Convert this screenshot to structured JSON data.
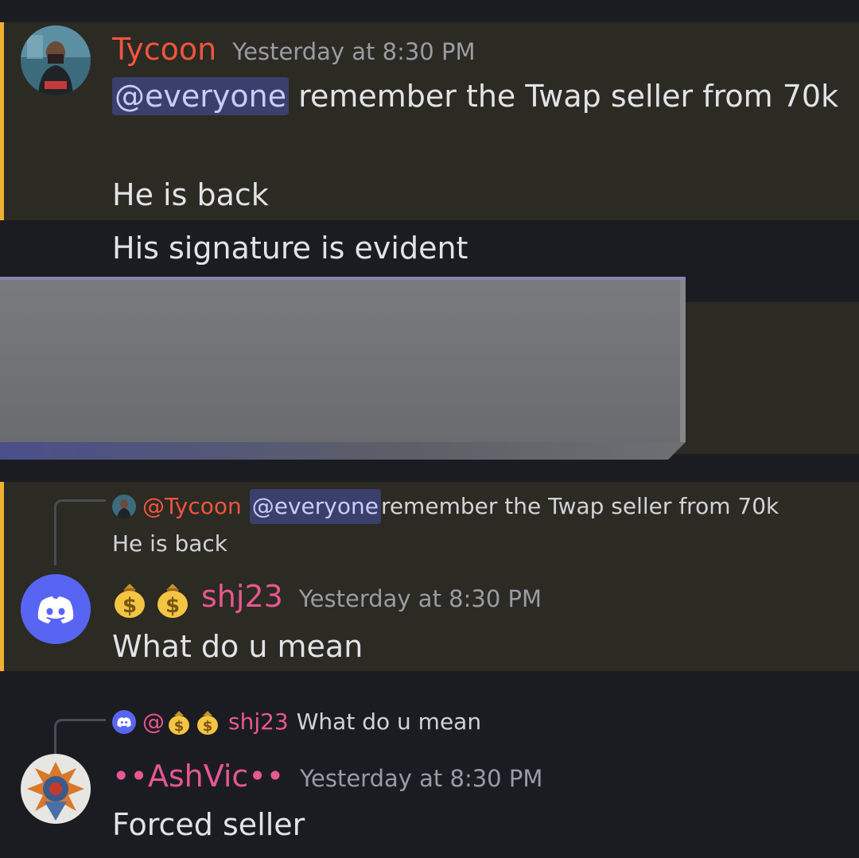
{
  "messages": [
    {
      "author": "Tycoon",
      "author_color": "#f0553f",
      "timestamp": "Yesterday at 8:30 PM",
      "mention": "@everyone",
      "line1_rest": " remember the Twap seller from 70k",
      "line2": "He is back"
    },
    {
      "text": "His signature is evident"
    },
    {
      "reply": {
        "author": "@Tycoon",
        "mention": "@everyone",
        "text_rest": " remember the Twap seller from 70k",
        "text_line2": "He is back"
      },
      "author_prefix_emoji": "moneybag-emoji",
      "author": "shj23",
      "author_color": "#e8578f",
      "timestamp": "Yesterday at 8:30 PM",
      "text": "What do u mean"
    },
    {
      "reply": {
        "author_at": "@",
        "author": "shj23",
        "text": "What do u mean"
      },
      "author": "••AshVic••",
      "author_color": "#e8578f",
      "timestamp": "Yesterday at 8:30 PM",
      "text": "Forced seller"
    }
  ],
  "colors": {
    "background": "#1b1c21",
    "highlight": "#2b2a23",
    "highlight_bar": "#f0b132",
    "mention_bg": "#3b3f6b",
    "mention_text": "#c9cdfb",
    "discord_blurple": "#5865f2"
  }
}
